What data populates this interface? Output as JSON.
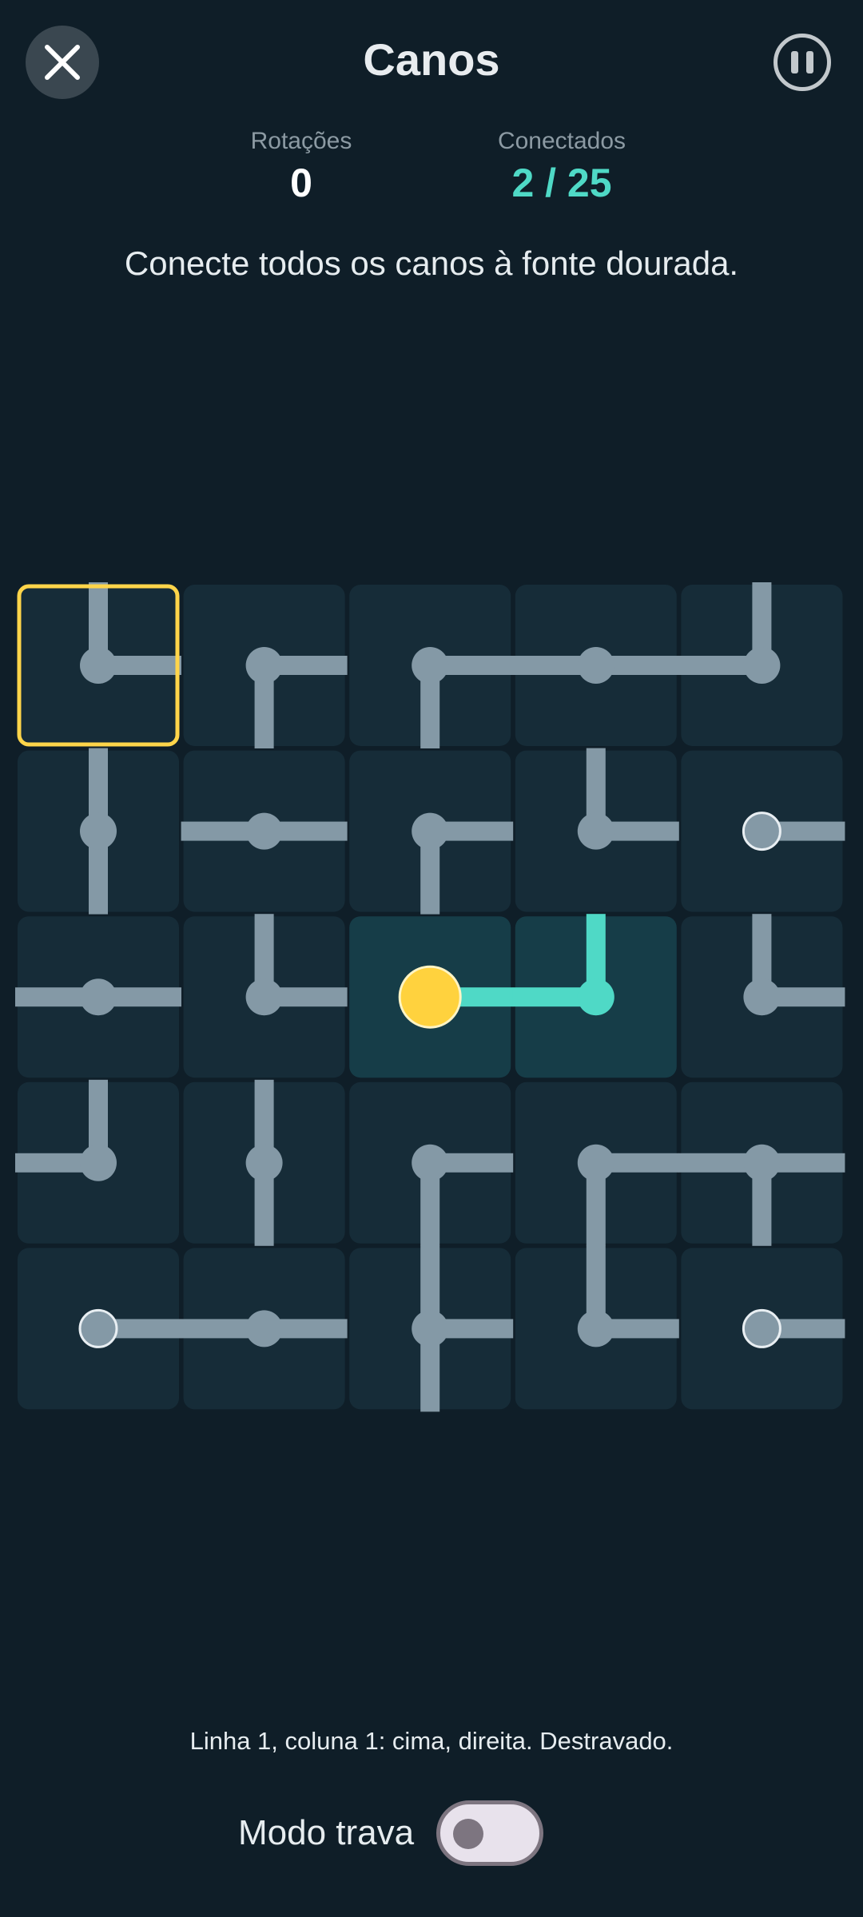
{
  "header": {
    "title": "Canos",
    "close_icon": "close-icon",
    "pause_icon": "pause-icon"
  },
  "stats": {
    "rotations_label": "Rotações",
    "rotations_value": "0",
    "connected_label": "Conectados",
    "connected_value": "2 / 25"
  },
  "instruction": "Conecte todos os canos à fonte dourada.",
  "board": {
    "rows": 5,
    "cols": 5,
    "selected": {
      "row": 1,
      "col": 1
    },
    "source": {
      "row": 3,
      "col": 3
    },
    "cells": [
      [
        {
          "dirs": [
            "up",
            "right"
          ],
          "kind": "elbow"
        },
        {
          "dirs": [
            "right",
            "down"
          ],
          "kind": "elbow"
        },
        {
          "dirs": [
            "right",
            "down"
          ],
          "kind": "elbow"
        },
        {
          "dirs": [
            "left",
            "right"
          ],
          "kind": "straight"
        },
        {
          "dirs": [
            "up",
            "left"
          ],
          "kind": "elbow"
        }
      ],
      [
        {
          "dirs": [
            "up",
            "down"
          ],
          "kind": "straight"
        },
        {
          "dirs": [
            "left",
            "right"
          ],
          "kind": "straight"
        },
        {
          "dirs": [
            "right",
            "down"
          ],
          "kind": "elbow"
        },
        {
          "dirs": [
            "up",
            "right"
          ],
          "kind": "elbow"
        },
        {
          "dirs": [
            "right"
          ],
          "kind": "endpoint"
        }
      ],
      [
        {
          "dirs": [
            "left",
            "right"
          ],
          "kind": "straight"
        },
        {
          "dirs": [
            "up",
            "right"
          ],
          "kind": "elbow"
        },
        {
          "dirs": [
            "right"
          ],
          "kind": "source",
          "connected": true
        },
        {
          "dirs": [
            "left",
            "up"
          ],
          "kind": "elbow",
          "connected": true
        },
        {
          "dirs": [
            "up",
            "right"
          ],
          "kind": "elbow"
        }
      ],
      [
        {
          "dirs": [
            "up",
            "left"
          ],
          "kind": "elbow"
        },
        {
          "dirs": [
            "up",
            "down"
          ],
          "kind": "straight"
        },
        {
          "dirs": [
            "right",
            "down"
          ],
          "kind": "elbow"
        },
        {
          "dirs": [
            "right",
            "down"
          ],
          "kind": "elbow"
        },
        {
          "dirs": [
            "left",
            "right",
            "down"
          ],
          "kind": "tee"
        }
      ],
      [
        {
          "dirs": [
            "right"
          ],
          "kind": "endpoint"
        },
        {
          "dirs": [
            "left",
            "right"
          ],
          "kind": "straight"
        },
        {
          "dirs": [
            "up",
            "right",
            "down"
          ],
          "kind": "tee"
        },
        {
          "dirs": [
            "up",
            "right"
          ],
          "kind": "elbow"
        },
        {
          "dirs": [
            "right"
          ],
          "kind": "endpoint"
        }
      ]
    ]
  },
  "status_text": "Linha 1, coluna 1: cima, direita. Destravado.",
  "lock_mode": {
    "label": "Modo trava",
    "enabled": false
  },
  "colors": {
    "background": "#0f1e28",
    "tile": "#162c38",
    "tile_connected": "#163d48",
    "pipe": "#8499a6",
    "pipe_connected": "#4fd9c6",
    "source": "#ffd23e",
    "selection": "#ffd54a",
    "connected_text": "#4fd9c6"
  }
}
